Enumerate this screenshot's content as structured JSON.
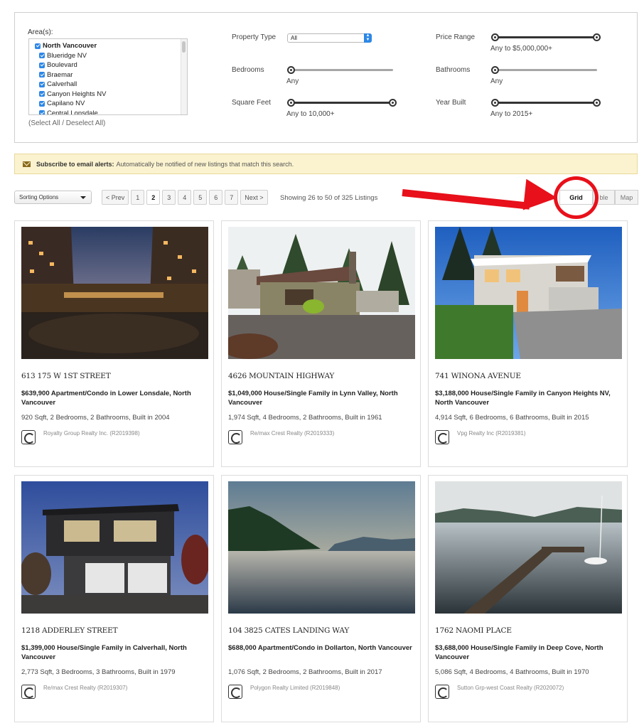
{
  "filters": {
    "area_label": "Area(s):",
    "areas": [
      "North Vancouver",
      "Blueridge NV",
      "Boulevard",
      "Braemar",
      "Calverhall",
      "Canyon Heights NV",
      "Capilano NV",
      "Central Lonsdale"
    ],
    "select_all": "(Select All / Deselect All)",
    "property_type_label": "Property Type",
    "property_type_value": "All",
    "bedrooms_label": "Bedrooms",
    "bedrooms_value": "Any",
    "square_feet_label": "Square Feet",
    "square_feet_value": "Any to 10,000+",
    "price_range_label": "Price Range",
    "price_range_value": "Any to $5,000,000+",
    "bathrooms_label": "Bathrooms",
    "bathrooms_value": "Any",
    "year_built_label": "Year Built",
    "year_built_value": "Any to 2015+"
  },
  "alert": {
    "bold": "Subscribe to email alerts:",
    "text": "Automatically be notified of new listings that match this search."
  },
  "toolbar": {
    "sort_label": "Sorting Options",
    "prev": "< Prev",
    "pages": [
      "1",
      "2",
      "3",
      "4",
      "5",
      "6",
      "7"
    ],
    "active_page": "2",
    "next": "Next >",
    "showing": "Showing 26 to 50 of 325 Listings",
    "views": {
      "grid": "Grid",
      "table": "ble",
      "map": "Map"
    }
  },
  "listings": [
    {
      "address": "613 175 W 1ST STREET",
      "price": "$639,900 Apartment/Condo in Lower Lonsdale, North Vancouver",
      "details": "920 Sqft, 2 Bedrooms, 2 Bathrooms, Built in 2004",
      "broker": "Royalty Group Realty Inc. (R2019398)"
    },
    {
      "address": "4626 MOUNTAIN HIGHWAY",
      "price": "$1,049,000 House/Single Family in Lynn Valley, North Vancouver",
      "details": "1,974 Sqft, 4 Bedrooms, 2 Bathrooms, Built in 1961",
      "broker": "Re/max Crest Realty (R2019333)"
    },
    {
      "address": "741 WINONA AVENUE",
      "price": "$3,188,000 House/Single Family in Canyon Heights NV, North Vancouver",
      "details": "4,914 Sqft, 6 Bedrooms, 6 Bathrooms, Built in 2015",
      "broker": "Vpg Realty Inc (R2019381)"
    },
    {
      "address": "1218 ADDERLEY STREET",
      "price": "$1,399,000 House/Single Family in Calverhall, North Vancouver",
      "details": "2,773 Sqft, 3 Bedrooms, 3 Bathrooms, Built in 1979",
      "broker": "Re/max Crest Realty (R2019307)"
    },
    {
      "address": "104 3825 CATES LANDING WAY",
      "price": "$688,000 Apartment/Condo in Dollarton, North Vancouver",
      "details": "1,076 Sqft, 2 Bedrooms, 2 Bathrooms, Built in 2017",
      "broker": "Polygon Realty Limited (R2019848)"
    },
    {
      "address": "1762 NAOMI PLACE",
      "price": "$3,688,000 House/Single Family in Deep Cove, North Vancouver",
      "details": "5,086 Sqft, 4 Bedrooms, 4 Bathrooms, Built in 1970",
      "broker": "Sutton Grp-west Coast Realty (R2020072)"
    }
  ]
}
